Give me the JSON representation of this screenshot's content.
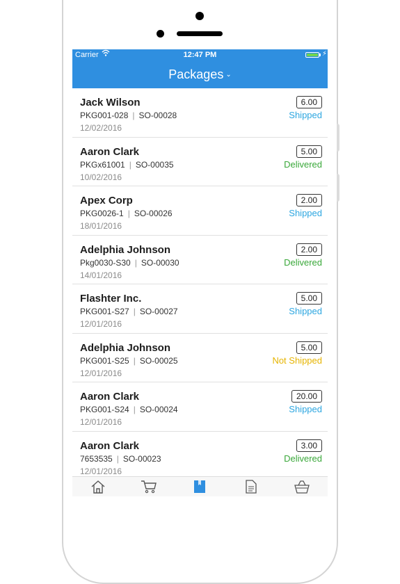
{
  "status_bar": {
    "carrier": "Carrier",
    "time": "12:47 PM"
  },
  "header": {
    "title": "Packages"
  },
  "colors": {
    "header_bg": "#2f8fe0",
    "shipped": "#2ca6e0",
    "delivered": "#3aa83a",
    "not_shipped": "#e6b400",
    "active_tab": "#2f8fe0"
  },
  "packages": [
    {
      "name": "Jack Wilson",
      "package": "PKG001-028",
      "order": "SO-00028",
      "date": "12/02/2016",
      "amount": "6.00",
      "status": "Shipped",
      "status_kind": "shipped"
    },
    {
      "name": "Aaron Clark",
      "package": "PKGx61001",
      "order": "SO-00035",
      "date": "10/02/2016",
      "amount": "5.00",
      "status": "Delivered",
      "status_kind": "delivered"
    },
    {
      "name": "Apex Corp",
      "package": "PKG0026-1",
      "order": "SO-00026",
      "date": "18/01/2016",
      "amount": "2.00",
      "status": "Shipped",
      "status_kind": "shipped"
    },
    {
      "name": "Adelphia Johnson",
      "package": "Pkg0030-S30",
      "order": "SO-00030",
      "date": "14/01/2016",
      "amount": "2.00",
      "status": "Delivered",
      "status_kind": "delivered"
    },
    {
      "name": "Flashter Inc.",
      "package": "PKG001-S27",
      "order": "SO-00027",
      "date": "12/01/2016",
      "amount": "5.00",
      "status": "Shipped",
      "status_kind": "shipped"
    },
    {
      "name": "Adelphia Johnson",
      "package": "PKG001-S25",
      "order": "SO-00025",
      "date": "12/01/2016",
      "amount": "5.00",
      "status": "Not Shipped",
      "status_kind": "not_shipped"
    },
    {
      "name": "Aaron Clark",
      "package": "PKG001-S24",
      "order": "SO-00024",
      "date": "12/01/2016",
      "amount": "20.00",
      "status": "Shipped",
      "status_kind": "shipped"
    },
    {
      "name": "Aaron Clark",
      "package": "7653535",
      "order": "SO-00023",
      "date": "12/01/2016",
      "amount": "3.00",
      "status": "Delivered",
      "status_kind": "delivered"
    }
  ],
  "tabbar": {
    "tabs": [
      {
        "icon": "home-icon",
        "active": false
      },
      {
        "icon": "cart-icon",
        "active": false
      },
      {
        "icon": "package-icon",
        "active": true
      },
      {
        "icon": "document-icon",
        "active": false
      },
      {
        "icon": "basket-icon",
        "active": false
      }
    ]
  }
}
